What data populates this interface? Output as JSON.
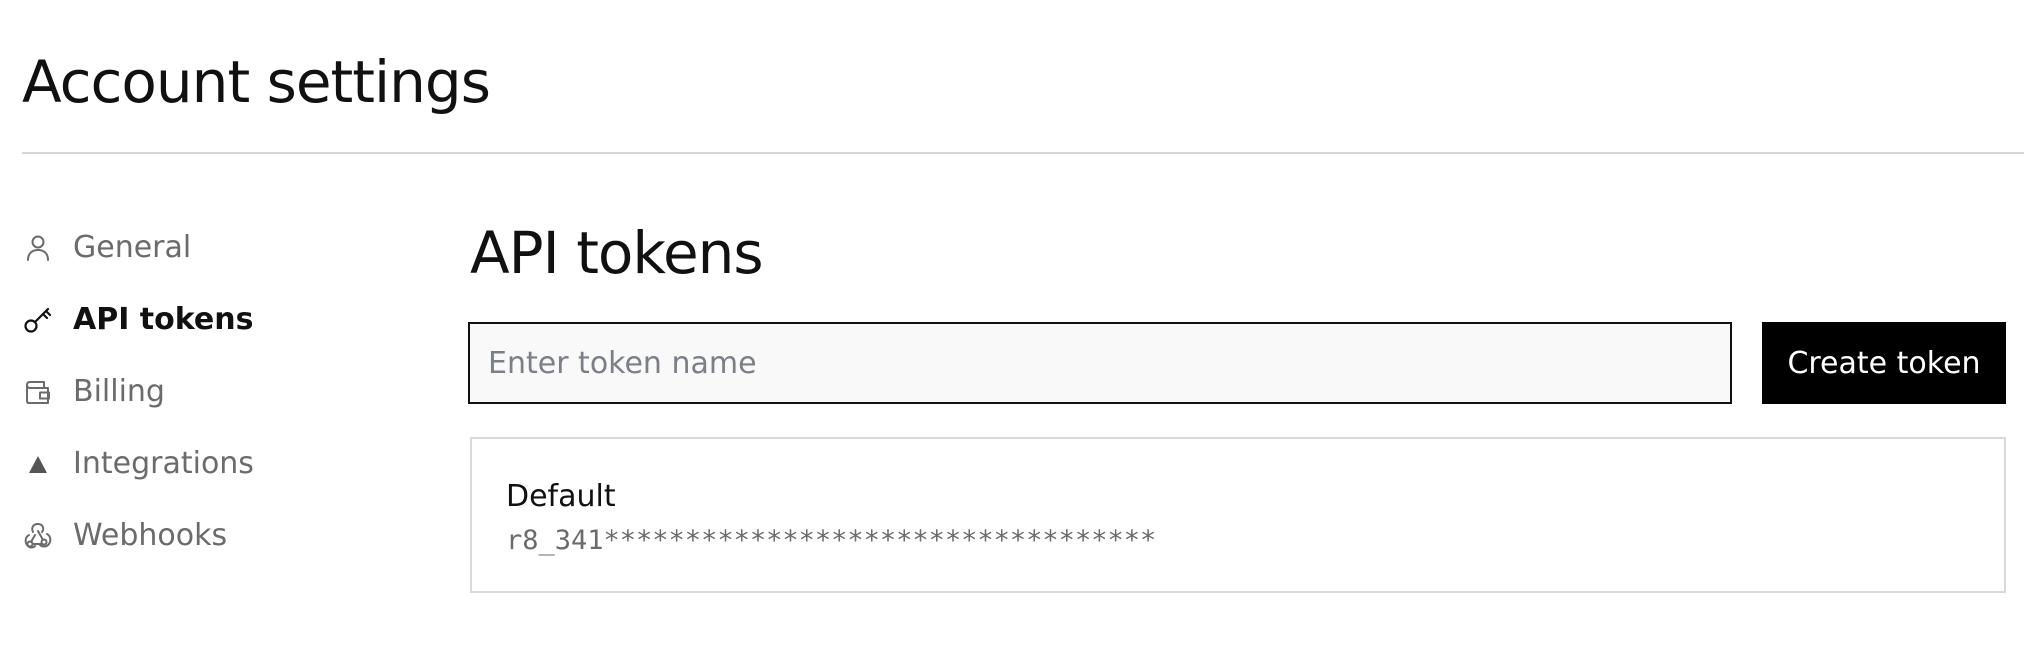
{
  "header": {
    "title": "Account settings"
  },
  "sidebar": {
    "items": [
      {
        "label": "General",
        "icon": "user-icon",
        "active": false
      },
      {
        "label": "API tokens",
        "icon": "key-icon",
        "active": true
      },
      {
        "label": "Billing",
        "icon": "wallet-icon",
        "active": false
      },
      {
        "label": "Integrations",
        "icon": "triangle-icon",
        "active": false
      },
      {
        "label": "Webhooks",
        "icon": "webhook-icon",
        "active": false
      }
    ]
  },
  "main": {
    "title": "API tokens",
    "token_input": {
      "value": "",
      "placeholder": "Enter token name"
    },
    "create_button_label": "Create token",
    "tokens": [
      {
        "name": "Default",
        "value": "r8_341**********************************"
      }
    ]
  },
  "colors": {
    "text": "#111111",
    "muted_text": "#6b6b6b",
    "button_background": "#000000",
    "button_text": "#ffffff",
    "input_background": "#f9f9f9",
    "divider": "#d6d6d6",
    "card_border": "#d9d9d9"
  }
}
